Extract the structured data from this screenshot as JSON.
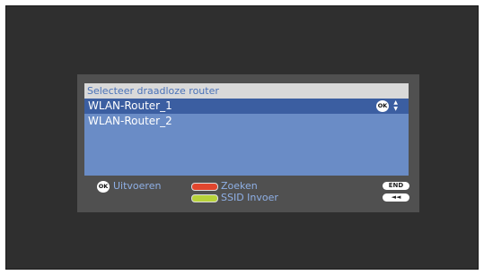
{
  "dialog": {
    "title": "Selecteer draadloze router",
    "routers": [
      {
        "name": "WLAN-Router_1",
        "selected": true
      },
      {
        "name": "WLAN-Router_2",
        "selected": false
      }
    ],
    "row_ok_badge": "OK",
    "row_updown_glyph": "▲▼"
  },
  "footer": {
    "ok_badge": "OK",
    "execute_label": "Uitvoeren",
    "search_label": "Zoeken",
    "ssid_label": "SSID Invoer",
    "end_key": "END",
    "back_key": "◄◄",
    "colors": {
      "search": "#e2462e",
      "ssid": "#b7d23a"
    }
  }
}
